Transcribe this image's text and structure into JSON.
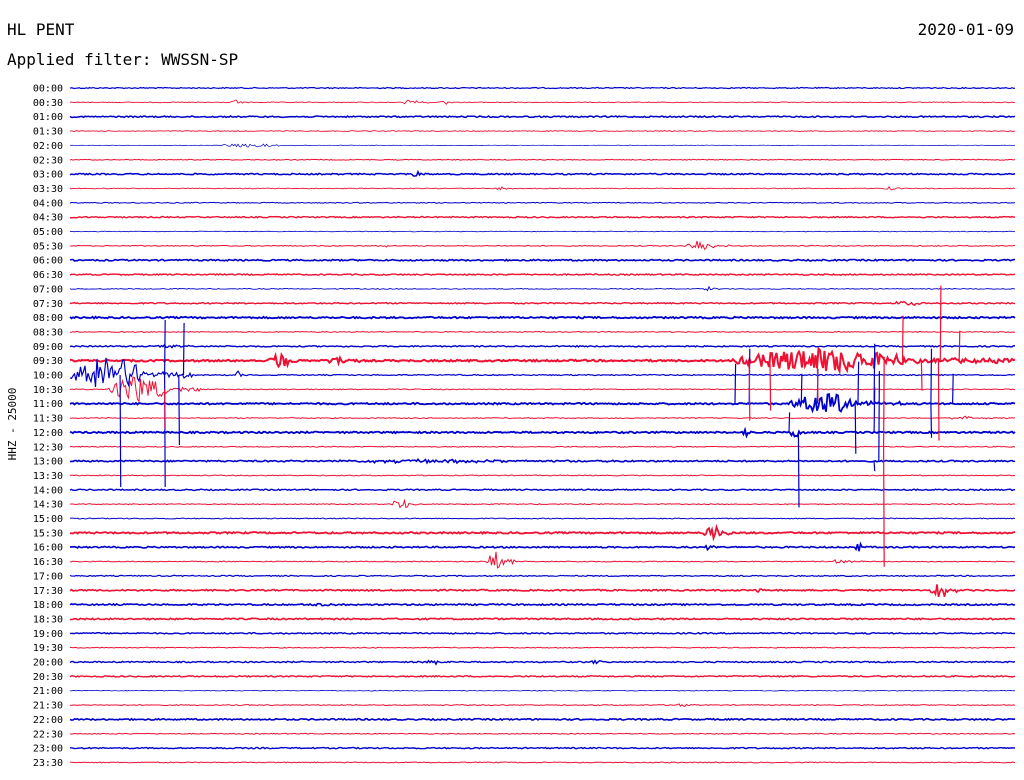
{
  "header": {
    "station": "HL PENT",
    "date": "2020-01-09",
    "filter": "Applied filter: WWSSN-SP"
  },
  "chart_data": {
    "type": "line",
    "title": "HL PENT",
    "ylabel": "HHZ - 25000",
    "time_labels": [
      "00:00",
      "00:30",
      "01:00",
      "01:30",
      "02:00",
      "02:30",
      "03:00",
      "03:30",
      "04:00",
      "04:30",
      "05:00",
      "05:30",
      "06:00",
      "06:30",
      "07:00",
      "07:30",
      "08:00",
      "08:30",
      "09:00",
      "09:30",
      "10:00",
      "10:30",
      "11:00",
      "11:30",
      "12:00",
      "12:30",
      "13:00",
      "13:30",
      "14:00",
      "14:30",
      "15:00",
      "15:30",
      "16:00",
      "16:30",
      "17:00",
      "17:30",
      "18:00",
      "18:30",
      "19:00",
      "19:30",
      "20:00",
      "20:30",
      "21:00",
      "21:30",
      "22:00",
      "22:30",
      "23:00",
      "23:30"
    ],
    "trace_minutes": 30,
    "colors": [
      "#0000cc",
      "#ee1133"
    ],
    "line_weights": [
      1.2,
      0.9,
      1.5,
      0.9,
      0.7,
      1.0,
      1.5,
      0.9,
      1.0,
      1.4,
      0.8,
      1.0,
      1.6,
      1.4,
      0.9,
      1.4,
      1.8,
      1.0,
      1.4,
      2.0,
      1.2,
      1.0,
      1.8,
      1.0,
      1.8,
      1.0,
      1.6,
      1.0,
      1.4,
      1.0,
      1.0,
      1.8,
      1.6,
      1.0,
      1.2,
      1.6,
      1.6,
      1.6,
      1.4,
      1.0,
      1.4,
      1.4,
      0.8,
      1.0,
      1.6,
      1.0,
      1.4,
      1.0
    ],
    "bursts": [
      {
        "trace": 1,
        "start": 0.17,
        "dur": 0.02,
        "amp": 2.5
      },
      {
        "trace": 1,
        "start": 0.35,
        "dur": 0.03,
        "amp": 2.5
      },
      {
        "trace": 1,
        "start": 0.39,
        "dur": 0.02,
        "amp": 2
      },
      {
        "trace": 4,
        "start": 0.15,
        "dur": 0.12,
        "amp": 1.5
      },
      {
        "trace": 6,
        "start": 0.36,
        "dur": 0.02,
        "amp": 2.5
      },
      {
        "trace": 7,
        "start": 0.45,
        "dur": 0.02,
        "amp": 2
      },
      {
        "trace": 7,
        "start": 0.86,
        "dur": 0.02,
        "amp": 2.5
      },
      {
        "trace": 11,
        "start": 0.33,
        "dur": 0.01,
        "amp": 3
      },
      {
        "trace": 11,
        "start": 0.65,
        "dur": 0.05,
        "amp": 6
      },
      {
        "trace": 14,
        "start": 0.67,
        "dur": 0.02,
        "amp": 2
      },
      {
        "trace": 15,
        "start": 0.87,
        "dur": 0.05,
        "amp": 2
      },
      {
        "trace": 18,
        "start": 0.09,
        "dur": 0.04,
        "amp": 2
      },
      {
        "trace": 19,
        "start": 0.21,
        "dur": 0.04,
        "amp": 8
      },
      {
        "trace": 19,
        "start": 0.27,
        "dur": 0.04,
        "amp": 4
      },
      {
        "trace": 19,
        "start": 0.7,
        "dur": 0.3,
        "amp": 12
      },
      {
        "trace": 20,
        "start": 0.0,
        "dur": 0.13,
        "amp": 18
      },
      {
        "trace": 20,
        "start": 0.175,
        "dur": 0.01,
        "amp": 4
      },
      {
        "trace": 21,
        "start": 0.04,
        "dur": 0.1,
        "amp": 14
      },
      {
        "trace": 22,
        "start": 0.76,
        "dur": 0.12,
        "amp": 10
      },
      {
        "trace": 23,
        "start": 0.93,
        "dur": 0.04,
        "amp": 2
      },
      {
        "trace": 24,
        "start": 0.71,
        "dur": 0.01,
        "amp": 6
      },
      {
        "trace": 24,
        "start": 0.76,
        "dur": 0.02,
        "amp": 8
      },
      {
        "trace": 26,
        "start": 0.28,
        "dur": 0.3,
        "amp": 1.5
      },
      {
        "trace": 29,
        "start": 0.34,
        "dur": 0.03,
        "amp": 6
      },
      {
        "trace": 31,
        "start": 0.67,
        "dur": 0.03,
        "amp": 8
      },
      {
        "trace": 32,
        "start": 0.67,
        "dur": 0.02,
        "amp": 3
      },
      {
        "trace": 32,
        "start": 0.83,
        "dur": 0.01,
        "amp": 6
      },
      {
        "trace": 33,
        "start": 0.44,
        "dur": 0.03,
        "amp": 14
      },
      {
        "trace": 33,
        "start": 0.8,
        "dur": 0.05,
        "amp": 2
      },
      {
        "trace": 35,
        "start": 0.72,
        "dur": 0.02,
        "amp": 2
      },
      {
        "trace": 35,
        "start": 0.91,
        "dur": 0.03,
        "amp": 9
      },
      {
        "trace": 36,
        "start": 0.25,
        "dur": 0.05,
        "amp": 1.5
      },
      {
        "trace": 40,
        "start": 0.37,
        "dur": 0.04,
        "amp": 2
      },
      {
        "trace": 40,
        "start": 0.55,
        "dur": 0.02,
        "amp": 2
      },
      {
        "trace": 43,
        "start": 0.64,
        "dur": 0.02,
        "amp": 1.5
      }
    ],
    "spikes": [
      {
        "trace": 20,
        "x": 0.053,
        "amp": -112
      },
      {
        "trace": 20,
        "x": 0.1,
        "amp": -112
      },
      {
        "trace": 20,
        "x": 0.1,
        "amp": 55
      },
      {
        "trace": 20,
        "x": 0.12,
        "amp": 52
      },
      {
        "trace": 20,
        "x": 0.115,
        "amp": -70
      },
      {
        "trace": 21,
        "x": 0.1,
        "amp": -40
      },
      {
        "trace": 22,
        "x": 0.703,
        "amp": 40
      },
      {
        "trace": 22,
        "x": 0.718,
        "amp": 55
      },
      {
        "trace": 22,
        "x": 0.773,
        "amp": 30
      },
      {
        "trace": 22,
        "x": 0.79,
        "amp": 35
      },
      {
        "trace": 22,
        "x": 0.833,
        "amp": 42
      },
      {
        "trace": 22,
        "x": 0.85,
        "amp": 60
      },
      {
        "trace": 22,
        "x": 0.91,
        "amp": 55
      },
      {
        "trace": 22,
        "x": 0.933,
        "amp": 30
      },
      {
        "trace": 22,
        "x": 0.83,
        "amp": -50
      },
      {
        "trace": 22,
        "x": 0.91,
        "amp": -34
      },
      {
        "trace": 24,
        "x": 0.77,
        "amp": -75
      },
      {
        "trace": 24,
        "x": 0.76,
        "amp": 20
      },
      {
        "trace": 24,
        "x": 0.85,
        "amp": 45
      },
      {
        "trace": 25,
        "x": 0.86,
        "amp": -120
      },
      {
        "trace": 25,
        "x": 0.86,
        "amp": 90
      },
      {
        "trace": 26,
        "x": 0.855,
        "amp": 90
      },
      {
        "trace": 26,
        "x": 0.85,
        "amp": -10
      },
      {
        "trace": 19,
        "x": 0.918,
        "amp": -80
      },
      {
        "trace": 19,
        "x": 0.718,
        "amp": -60
      },
      {
        "trace": 19,
        "x": 0.74,
        "amp": -50
      },
      {
        "trace": 19,
        "x": 0.79,
        "amp": -40
      },
      {
        "trace": 19,
        "x": 0.9,
        "amp": -30
      },
      {
        "trace": 19,
        "x": 0.92,
        "amp": 75
      },
      {
        "trace": 19,
        "x": 0.88,
        "amp": 45
      },
      {
        "trace": 19,
        "x": 0.94,
        "amp": 30
      }
    ]
  }
}
